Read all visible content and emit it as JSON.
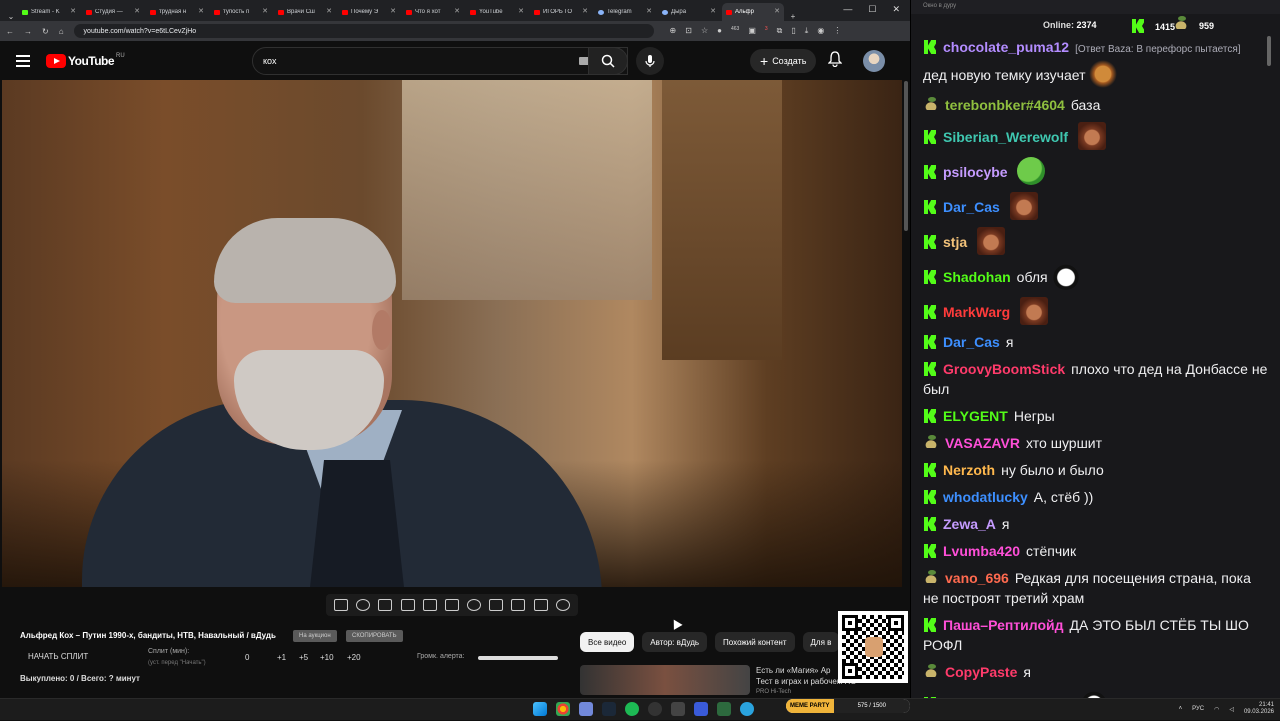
{
  "browser": {
    "tabs": [
      {
        "label": "Stream - K",
        "favicon": "kick",
        "active": false
      },
      {
        "label": "Студия —",
        "favicon": "youtube",
        "active": false
      },
      {
        "label": "трудная н",
        "favicon": "youtube",
        "active": false
      },
      {
        "label": "тупость п",
        "favicon": "youtube",
        "active": false
      },
      {
        "label": "Врачи Сш",
        "favicon": "youtube",
        "active": false
      },
      {
        "label": "Почему Э",
        "favicon": "youtube",
        "active": false
      },
      {
        "label": "Что я хот",
        "favicon": "youtube",
        "active": false
      },
      {
        "label": "YouTube",
        "favicon": "youtube",
        "active": false
      },
      {
        "label": "ИГОРЬ ГО",
        "favicon": "youtube",
        "active": false
      },
      {
        "label": "Telegram",
        "favicon": "globe",
        "active": false
      },
      {
        "label": "Дыра",
        "favicon": "globe",
        "active": false
      },
      {
        "label": "Альфр",
        "favicon": "youtube",
        "active": true
      }
    ],
    "new_tab": "+",
    "url": "youtube.com/watch?v=e6tLCevZjHo",
    "extension_badges": [
      "463",
      "3"
    ]
  },
  "youtube": {
    "logo_text": "YouTube",
    "region": "RU",
    "search_value": "кох",
    "create_label": "Создать",
    "video_title": "Альфред Кох – Путин 1990-х, бандиты, НТВ, Навальный / вДудь",
    "tags": [
      "На аукцион",
      "СКОПИРОВАТЬ"
    ],
    "split_button": "НАЧАТЬ СПЛИТ",
    "split_label": "Сплит (мин):",
    "split_sub": "(уст. перед \"Начать\")",
    "split_values": [
      "0",
      "+1",
      "+5",
      "+10",
      "+20"
    ],
    "volume_label": "Громк. алерта:",
    "bought_text": "Выкуплено: 0 / Всего: ? минут",
    "filters": [
      "Все видео",
      "Автор: вДудь",
      "Похожий контент",
      "Для в"
    ],
    "rec_text_1": "Есть ли «Магия» Ар",
    "rec_text_2": "Тест в играх и рабочем ПО...",
    "rec_text_3": "PRO Hi-Tech"
  },
  "chat": {
    "window_title": "Окно в дуру",
    "online_label": "Online:",
    "online_count": "2374",
    "kick_count": "1415",
    "other_count": "959",
    "messages": [
      {
        "platform": "kick",
        "user": "chocolate_puma12",
        "color": "#b38cff",
        "reply": "[Ответ Baza: В перефорс пытается]",
        "text": "дед новую темку изучает",
        "emote": "jerry"
      },
      {
        "platform": "other",
        "user": "terebonbker#4604",
        "color": "#8fbf3f",
        "reply": "",
        "text": "база",
        "emote": ""
      },
      {
        "platform": "kick",
        "user": "Siberian_Werewolf",
        "color": "#3fc7b0",
        "reply": "",
        "text": "",
        "emote": "kasket"
      },
      {
        "platform": "kick",
        "user": "psilocybe",
        "color": "#c59bff",
        "reply": "",
        "text": "",
        "emote": "pepe"
      },
      {
        "platform": "kick",
        "user": "Dar_Cas",
        "color": "#3d8fff",
        "reply": "",
        "text": "",
        "emote": "kasket"
      },
      {
        "platform": "kick",
        "user": "stja",
        "color": "#f2c27a",
        "reply": "",
        "text": "",
        "emote": "kasket"
      },
      {
        "platform": "kick",
        "user": "Shadohan",
        "color": "#53fc18",
        "reply": "",
        "text": "обля",
        "emote": "joker"
      },
      {
        "platform": "kick",
        "user": "MarkWarg",
        "color": "#ff3b3b",
        "reply": "",
        "text": "",
        "emote": "kasket"
      },
      {
        "platform": "kick",
        "user": "Dar_Cas",
        "color": "#3d8fff",
        "reply": "",
        "text": "я",
        "emote": ""
      },
      {
        "platform": "kick",
        "user": "GroovyBoomStick",
        "color": "#ff3b6b",
        "reply": "",
        "text": "плохо что дед на Донбассе не был",
        "emote": ""
      },
      {
        "platform": "kick",
        "user": "ELYGENT",
        "color": "#53fc18",
        "reply": "",
        "text": "Негры",
        "emote": ""
      },
      {
        "platform": "other",
        "user": "VASAZAVR",
        "color": "#ff4fd8",
        "reply": "",
        "text": "хто шуршит",
        "emote": ""
      },
      {
        "platform": "kick",
        "user": "Nerzoth",
        "color": "#ffb84d",
        "reply": "",
        "text": "ну было и было",
        "emote": ""
      },
      {
        "platform": "kick",
        "user": "whodatlucky",
        "color": "#3d8fff",
        "reply": "",
        "text": "А, стёб ))",
        "emote": ""
      },
      {
        "platform": "kick",
        "user": "Zewa_A",
        "color": "#c59bff",
        "reply": "",
        "text": "я",
        "emote": ""
      },
      {
        "platform": "kick",
        "user": "Lvumba420",
        "color": "#ff4fd8",
        "reply": "",
        "text": "стёпчик",
        "emote": ""
      },
      {
        "platform": "other",
        "user": "vano_696",
        "color": "#ff6a4f",
        "reply": "",
        "text": "Редкая для посещения страна, пока не построят третий храм",
        "emote": ""
      },
      {
        "platform": "kick",
        "user": "Паша–Рептилойд",
        "color": "#ff4fd8",
        "reply": "",
        "text": "ДА ЭТО БЫЛ СТЁБ ТЫ ШО РОФЛ",
        "emote": ""
      },
      {
        "platform": "other",
        "user": "CopyPaste",
        "color": "#ff3b6b",
        "reply": "",
        "text": "я",
        "emote": ""
      },
      {
        "platform": "kick",
        "user": "Shadohan",
        "color": "#53fc18",
        "reply": "",
        "text": "вопросик",
        "emote": "joker"
      }
    ]
  },
  "taskbar": {
    "meme_party_label": "MEME PARTY",
    "meme_party_progress": "575 / 1500",
    "language": "РУС",
    "time": "21:41",
    "date": "09.03.2026"
  }
}
